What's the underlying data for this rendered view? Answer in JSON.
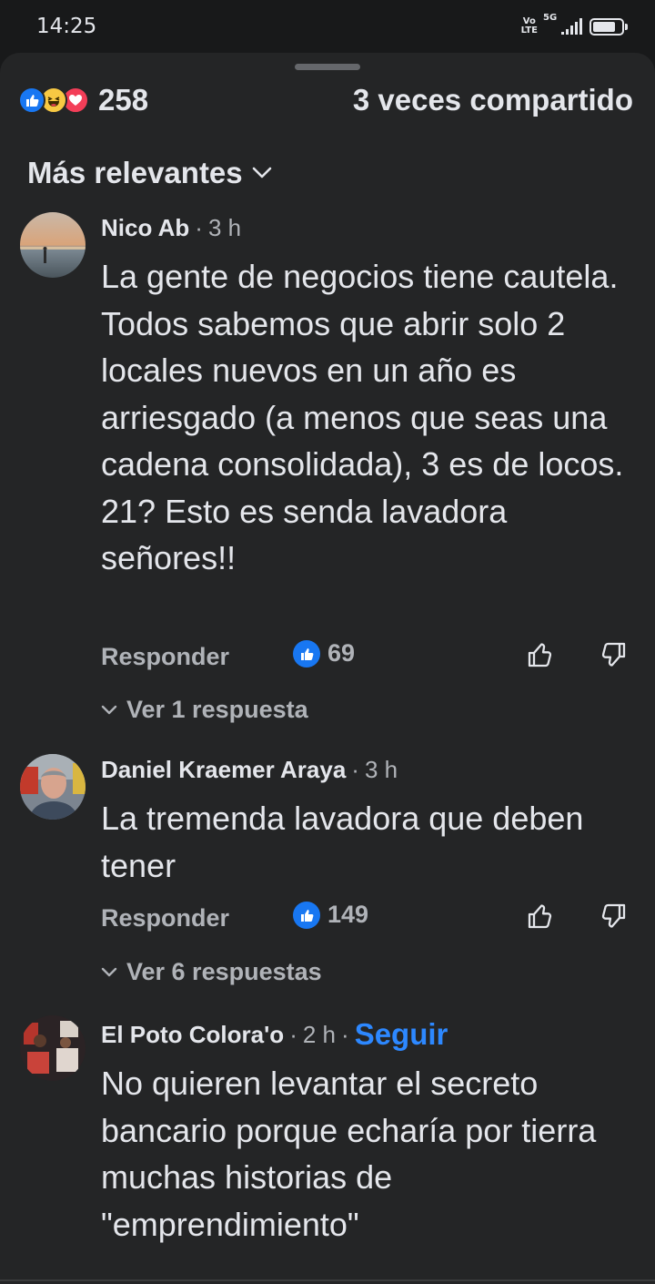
{
  "status_bar": {
    "time": "14:25",
    "volte_top": "Vo",
    "volte_bottom": "LTE",
    "network": "5G",
    "battery_level": 0.8
  },
  "post_summary": {
    "reaction_icons": [
      "like-icon",
      "haha-icon",
      "love-icon"
    ],
    "reaction_count": "258",
    "shares_label": "3 veces compartido"
  },
  "sort": {
    "label": "Más relevantes"
  },
  "comments": [
    {
      "author": "Nico Ab",
      "time": "3 h",
      "text": "La gente de negocios tiene cautela. Todos sabemos que abrir solo 2 locales nuevos en un año es arriesgado (a menos que seas una cadena consolidada), 3 es de locos. 21? Esto es senda lavadora señores!!",
      "reply_label": "Responder",
      "likes": "69",
      "replies_label": "Ver 1 respuesta"
    },
    {
      "author": "Daniel Kraemer Araya",
      "time": "3 h",
      "text": "La tremenda lavadora que deben tener",
      "reply_label": "Responder",
      "likes": "149",
      "replies_label": "Ver 6 respuestas"
    },
    {
      "author": "El Poto Colora'o",
      "time": "2 h",
      "follow_label": "Seguir",
      "text": "No quieren levantar el secreto bancario porque echaría por tierra muchas historias de \"emprendimiento\""
    }
  ],
  "colors": {
    "background": "#18191a",
    "sheet": "#242526",
    "text": "#e4e6eb",
    "secondary_text": "#b0b3b8",
    "accent": "#1877f2",
    "link": "#2d88ff"
  }
}
